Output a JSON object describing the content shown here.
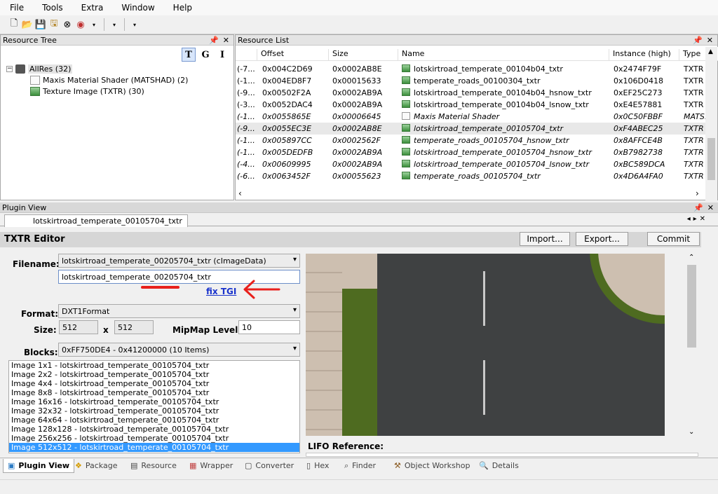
{
  "menu": [
    "File",
    "Tools",
    "Extra",
    "Window",
    "Help"
  ],
  "resource_tree": {
    "title": "Resource Tree",
    "tools": [
      "T",
      "G",
      "I"
    ],
    "root": "AllRes (32)",
    "children": [
      "Maxis Material Shader (MATSHAD) (2)",
      "Texture Image (TXTR) (30)"
    ]
  },
  "resource_list": {
    "title": "Resource List",
    "columns": [
      "Offset",
      "Size",
      "Name",
      "Instance (high)",
      "Type"
    ],
    "rows": [
      {
        "pre": "(-7...",
        "offset": "0x004C2D69",
        "size": "0x0002AB8E",
        "name": "lotskirtroad_temperate_00104b04_txtr",
        "inst": "0x2474F79F",
        "type": "TXTR",
        "icon": "image",
        "italic": false,
        "selected": false
      },
      {
        "pre": "(-1...",
        "offset": "0x004ED8F7",
        "size": "0x00015633",
        "name": "temperate_roads_00100304_txtr",
        "inst": "0x106D0418",
        "type": "TXTR",
        "icon": "image",
        "italic": false,
        "selected": false
      },
      {
        "pre": "(-9...",
        "offset": "0x00502F2A",
        "size": "0x0002AB9A",
        "name": "lotskirtroad_temperate_00104b04_hsnow_txtr",
        "inst": "0xEF25C273",
        "type": "TXTR",
        "icon": "image",
        "italic": false,
        "selected": false
      },
      {
        "pre": "(-3...",
        "offset": "0x0052DAC4",
        "size": "0x0002AB9A",
        "name": "lotskirtroad_temperate_00104b04_lsnow_txtr",
        "inst": "0xE4E57881",
        "type": "TXTR",
        "icon": "image",
        "italic": false,
        "selected": false
      },
      {
        "pre": "(-1...",
        "offset": "0x0055865E",
        "size": "0x00006645",
        "name": "Maxis Material Shader",
        "inst": "0x0C50FBBF",
        "type": "MATS...",
        "icon": "doc",
        "italic": true,
        "selected": false
      },
      {
        "pre": "(-9...",
        "offset": "0x0055EC3E",
        "size": "0x0002AB8E",
        "name": "lotskirtroad_temperate_00105704_txtr",
        "inst": "0xF4ABEC25",
        "type": "TXTR",
        "icon": "image",
        "italic": true,
        "selected": true
      },
      {
        "pre": "(-1...",
        "offset": "0x005897CC",
        "size": "0x0002562F",
        "name": "temperate_roads_00105704_hsnow_txtr",
        "inst": "0x8AFFCE4B",
        "type": "TXTR",
        "icon": "image",
        "italic": true,
        "selected": false
      },
      {
        "pre": "(-1...",
        "offset": "0x005DEDFB",
        "size": "0x0002AB9A",
        "name": "lotskirtroad_temperate_00105704_hsnow_txtr",
        "inst": "0xB7982738",
        "type": "TXTR",
        "icon": "image",
        "italic": true,
        "selected": false
      },
      {
        "pre": "(-4...",
        "offset": "0x00609995",
        "size": "0x0002AB9A",
        "name": "lotskirtroad_temperate_00105704_lsnow_txtr",
        "inst": "0xBC589DCA",
        "type": "TXTR",
        "icon": "image",
        "italic": true,
        "selected": false
      },
      {
        "pre": "(-6...",
        "offset": "0x0063452F",
        "size": "0x00055623",
        "name": "temperate_roads_00105704_txtr",
        "inst": "0x4D6A4FA0",
        "type": "TXTR",
        "icon": "image",
        "italic": true,
        "selected": false
      }
    ]
  },
  "plugin_view": {
    "title": "Plugin View",
    "doc_tab": "lotskirtroad_temperate_00105704_txtr",
    "editor_title": "TXTR Editor",
    "buttons": {
      "import": "Import...",
      "export": "Export...",
      "commit": "Commit"
    },
    "filename_label": "Filename:",
    "filename_combo": "lotskirtroad_temperate_00205704_txtr (cImageData)",
    "filename_value": "lotskirtroad_temperate_00205704_txtr",
    "fix_tgi": "fix TGI",
    "format_label": "Format:",
    "format_value": "DXT1Format",
    "size_label": "Size:",
    "size_w": "512",
    "size_x": "x",
    "size_h": "512",
    "mipmap_label": "MipMap Level:",
    "mipmap_value": "10",
    "blocks_label": "Blocks:",
    "blocks_value": "0xFF750DE4 - 0x41200000 (10 Items)",
    "images": [
      "Image 1x1 - lotskirtroad_temperate_00105704_txtr",
      "Image 2x2 - lotskirtroad_temperate_00105704_txtr",
      "Image 4x4 - lotskirtroad_temperate_00105704_txtr",
      "Image 8x8 - lotskirtroad_temperate_00105704_txtr",
      "Image 16x16 - lotskirtroad_temperate_00105704_txtr",
      "Image 32x32 - lotskirtroad_temperate_00105704_txtr",
      "Image 64x64 - lotskirtroad_temperate_00105704_txtr",
      "Image 128x128 - lotskirtroad_temperate_00105704_txtr",
      "Image 256x256 - lotskirtroad_temperate_00105704_txtr",
      "Image 512x512 - lotskirtroad_temperate_00105704_txtr"
    ],
    "selected_image_index": 9,
    "lifo_label": "LIFO Reference:"
  },
  "bottom_tabs": [
    "Plugin View",
    "Package",
    "Resource",
    "Wrapper",
    "Converter",
    "Hex",
    "Finder",
    "Object Workshop",
    "Details"
  ],
  "colors": {
    "accent_red": "#e8201c",
    "link_blue": "#1a33cc",
    "selection_blue": "#3399ff"
  }
}
